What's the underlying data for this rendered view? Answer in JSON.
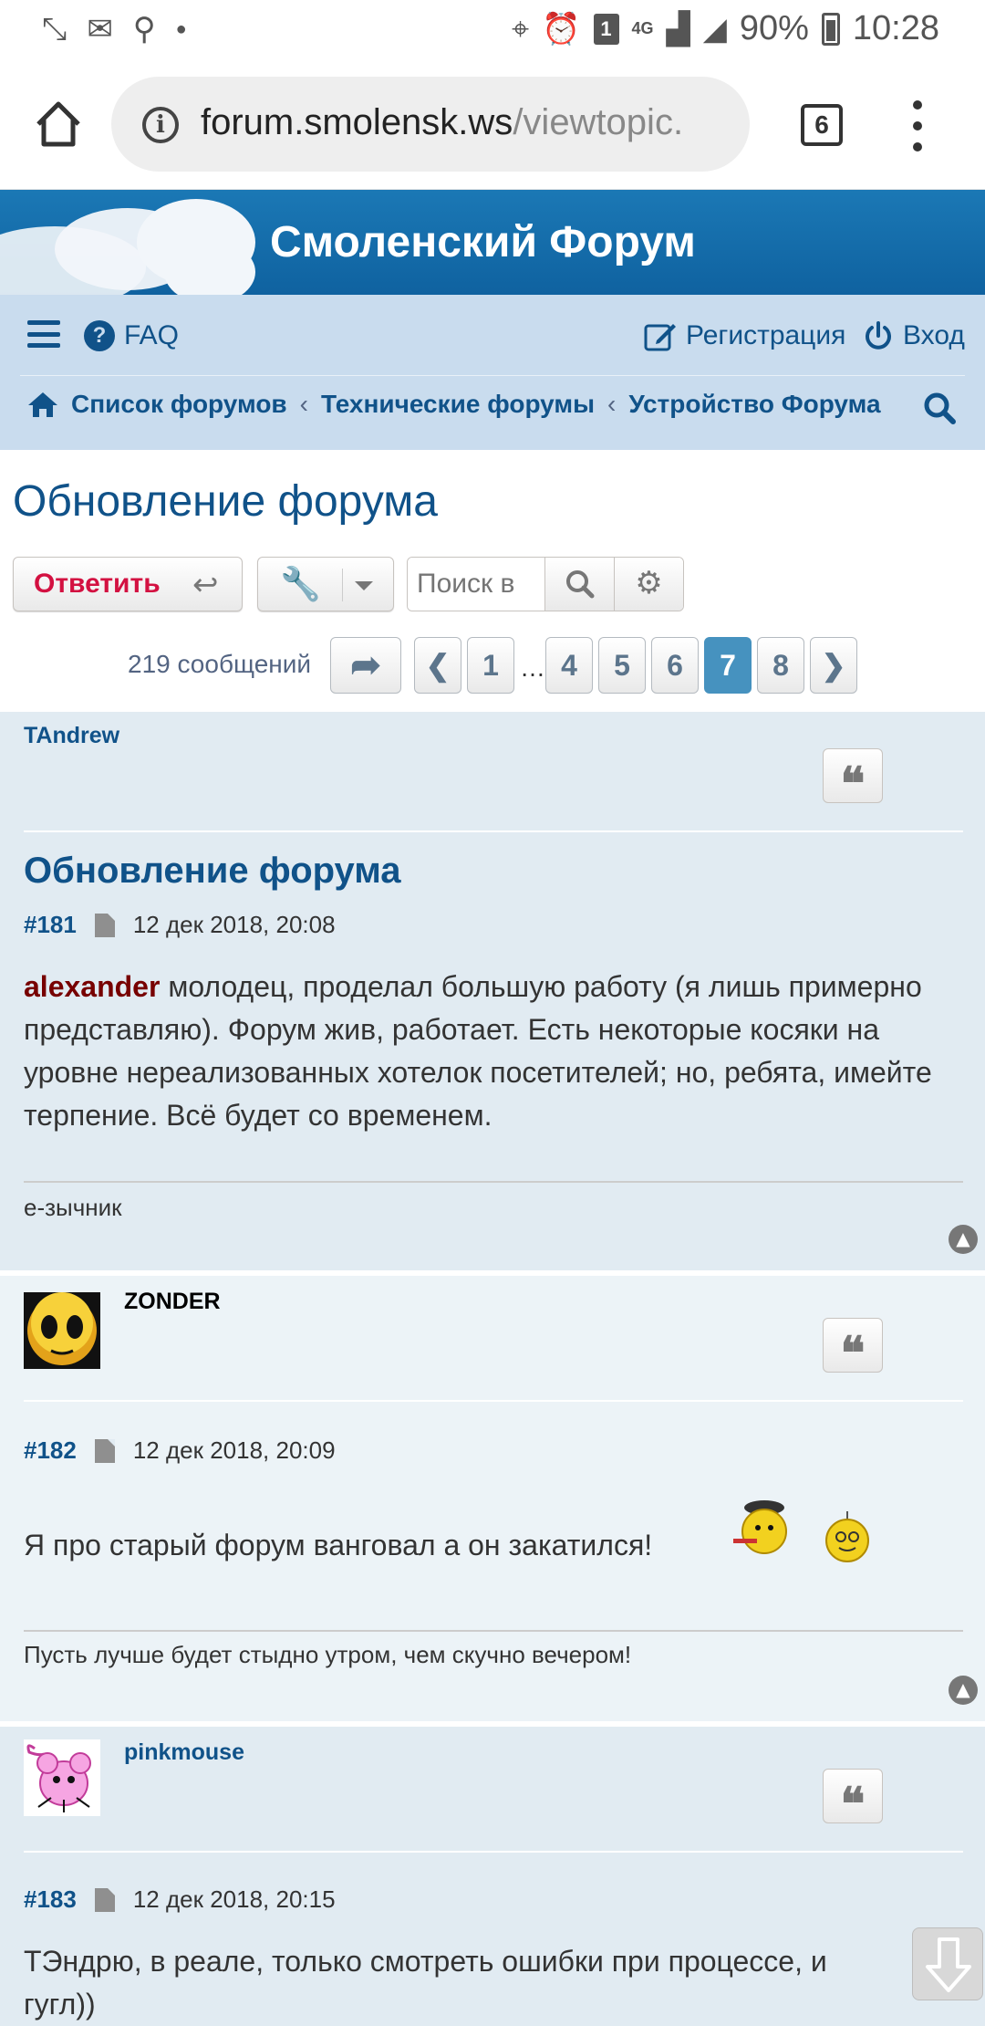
{
  "status_bar": {
    "battery": "90%",
    "time": "10:28",
    "network": "4G",
    "notification_count": "1"
  },
  "browser": {
    "url_host": "forum.smolensk.ws",
    "url_path": "/viewtopic.",
    "tab_count": "6"
  },
  "site": {
    "title": "Смоленский Форум"
  },
  "nav": {
    "faq": "FAQ",
    "register": "Регистрация",
    "login": "Вход",
    "breadcrumbs": [
      "Список форумов",
      "Технические форумы",
      "Устройство Форума"
    ]
  },
  "topic": {
    "title": "Обновление форума",
    "reply_label": "Ответить",
    "search_placeholder": "Поиск в",
    "post_count": "219 сообщений",
    "pages": [
      "1",
      "4",
      "5",
      "6",
      "7",
      "8"
    ],
    "current_page": "7",
    "ellipsis": "…"
  },
  "posts": [
    {
      "author": "TAndrew",
      "title": "Обновление форума",
      "number": "#181",
      "date": "12 дек 2018, 20:08",
      "mention": "alexander",
      "text": " молодец, проделал большую работу (я лишь примерно представляю). Форум жив, работает. Есть некоторые косяки на уровне нереализованных хотелок посетителей; но, ребята, имейте терпение. Всё будет со временем.",
      "signature": "е-зычник"
    },
    {
      "author": "ZONDER",
      "number": "#182",
      "date": "12 дек 2018, 20:09",
      "text": "Я про старый форум ванговал а он закатился!",
      "signature": "Пусть лучше будет стыдно утром, чем скучно вечером!"
    },
    {
      "author": "pinkmouse",
      "number": "#183",
      "date": "12 дек 2018, 20:15",
      "text": "ТЭндрю, в реале, только смотреть ошибки при процессе, и гугл))"
    }
  ]
}
